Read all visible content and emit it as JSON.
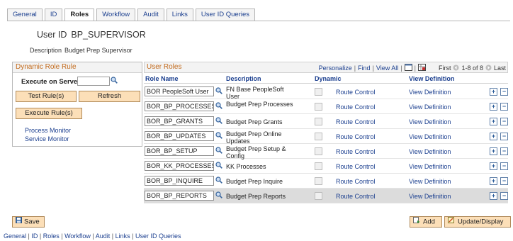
{
  "tabs": [
    "General",
    "ID",
    "Roles",
    "Workflow",
    "Audit",
    "Links",
    "User ID Queries"
  ],
  "active_tab": "Roles",
  "user": {
    "id_label": "User ID",
    "id_value": "BP_SUPERVISOR",
    "desc_label": "Description",
    "desc_value": "Budget Prep Supervisor"
  },
  "dynamic_role_rule": {
    "title": "Dynamic Role Rule",
    "execute_on_server_label": "Execute on Server",
    "execute_on_server_value": "",
    "test_rules_label": "Test Rule(s)",
    "refresh_label": "Refresh",
    "execute_rules_label": "Execute Rule(s)",
    "process_monitor": "Process Monitor",
    "service_monitor": "Service Monitor"
  },
  "user_roles": {
    "title": "User Roles",
    "personalize": "Personalize",
    "find": "Find",
    "view_all": "View All",
    "first": "First",
    "range": "1-8 of 8",
    "last": "Last",
    "columns": {
      "role_name": "Role Name",
      "description": "Description",
      "dynamic": "Dynamic",
      "view_definition": "View Definition"
    },
    "rows": [
      {
        "role": "BOR PeopleSoft User",
        "description": "FN Base PeopleSoft User",
        "route": "Route Control",
        "view": "View Definition"
      },
      {
        "role": "BOR_BP_PROCESSES",
        "description": "Budget Prep Processes",
        "route": "Route Control",
        "view": "View Definition"
      },
      {
        "role": "BOR_BP_GRANTS",
        "description": "Budget Prep Grants",
        "route": "Route Control",
        "view": "View Definition"
      },
      {
        "role": "BOR_BP_UPDATES",
        "description": "Budget Prep Online Updates",
        "route": "Route Control",
        "view": "View Definition"
      },
      {
        "role": "BOR_BP_SETUP",
        "description": "Budget Prep Setup & Config",
        "route": "Route Control",
        "view": "View Definition"
      },
      {
        "role": "BOR_KK_PROCESSES",
        "description": "KK Processes",
        "route": "Route Control",
        "view": "View Definition"
      },
      {
        "role": "BOR_BP_INQUIRE",
        "description": "Budget Prep Inquire",
        "route": "Route Control",
        "view": "View Definition"
      },
      {
        "role": "BOR_BP_REPORTS",
        "description": "Budget Prep Reports",
        "route": "Route Control",
        "view": "View Definition"
      }
    ]
  },
  "buttons": {
    "save": "Save",
    "add": "Add",
    "update_display": "Update/Display"
  },
  "footer_links": [
    "General",
    "ID",
    "Roles",
    "Workflow",
    "Audit",
    "Links",
    "User ID Queries"
  ],
  "colors": {
    "link": "#1b3f8f",
    "section_title": "#c26a1c",
    "button_bg": "#fcdfb8"
  }
}
